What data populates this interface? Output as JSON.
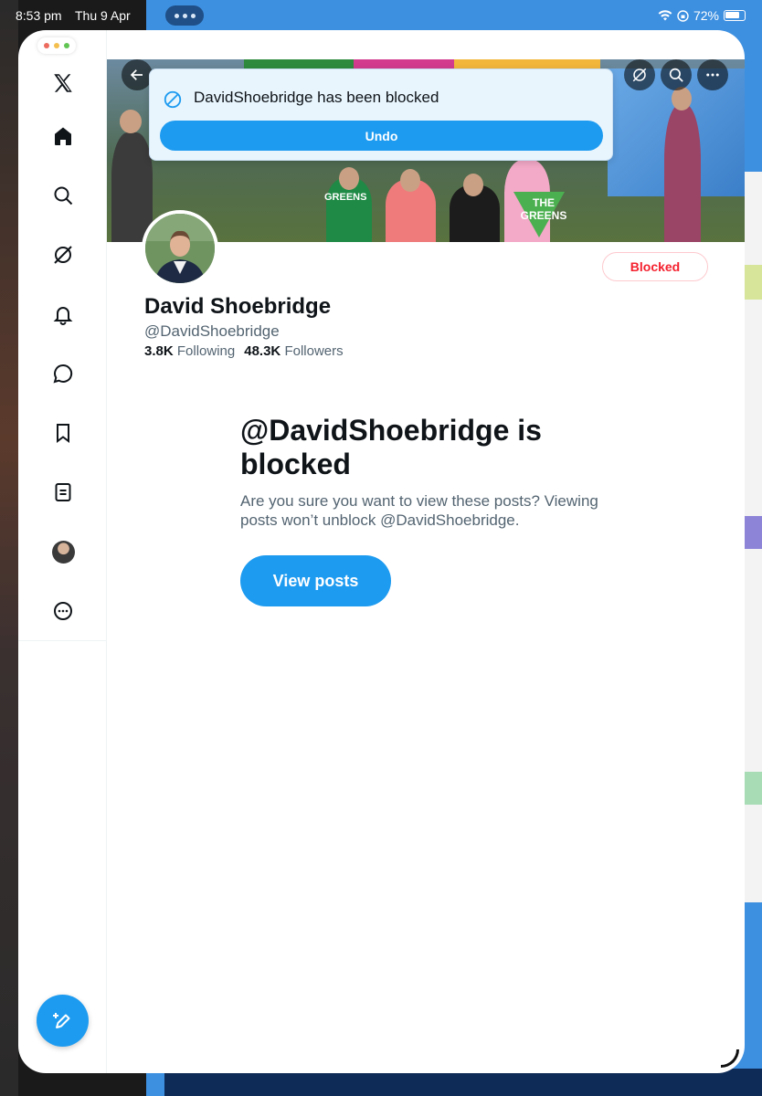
{
  "status_bar": {
    "time": "8:53 pm",
    "date": "Thu 9 Apr",
    "battery": "72%"
  },
  "sidebar": {
    "logo": "x-logo-icon",
    "items": [
      {
        "icon": "home-icon",
        "label": "Home"
      },
      {
        "icon": "search-icon",
        "label": "Explore"
      },
      {
        "icon": "grok-icon",
        "label": "Grok"
      },
      {
        "icon": "bell-icon",
        "label": "Notifications"
      },
      {
        "icon": "message-icon",
        "label": "Messages"
      },
      {
        "icon": "bookmark-icon",
        "label": "Bookmarks"
      },
      {
        "icon": "lists-icon",
        "label": "Lists"
      },
      {
        "icon": "avatar",
        "label": "Profile"
      },
      {
        "icon": "more-icon",
        "label": "More"
      }
    ],
    "compose_icon": "compose-icon"
  },
  "toast": {
    "message": "DavidShoebridge has been blocked",
    "undo_label": "Undo"
  },
  "banner": {
    "sign_text_1": "THE GREENS",
    "sign_text_2": "GREENS"
  },
  "profile": {
    "display_name": "David Shoebridge",
    "handle": "@DavidShoebridge",
    "following_count": "3.8K",
    "following_label": "Following",
    "followers_count": "48.3K",
    "followers_label": "Followers",
    "blocked_button": "Blocked"
  },
  "blocked_notice": {
    "title": "@DavidShoebridge is blocked",
    "description": "Are you sure you want to view these posts? Viewing posts won’t unblock @DavidShoebridge.",
    "view_posts_label": "View posts"
  },
  "colors": {
    "accent": "#1d9bf0",
    "blocked_red": "#f4212e",
    "text_primary": "#0f1419",
    "text_secondary": "#536471"
  }
}
